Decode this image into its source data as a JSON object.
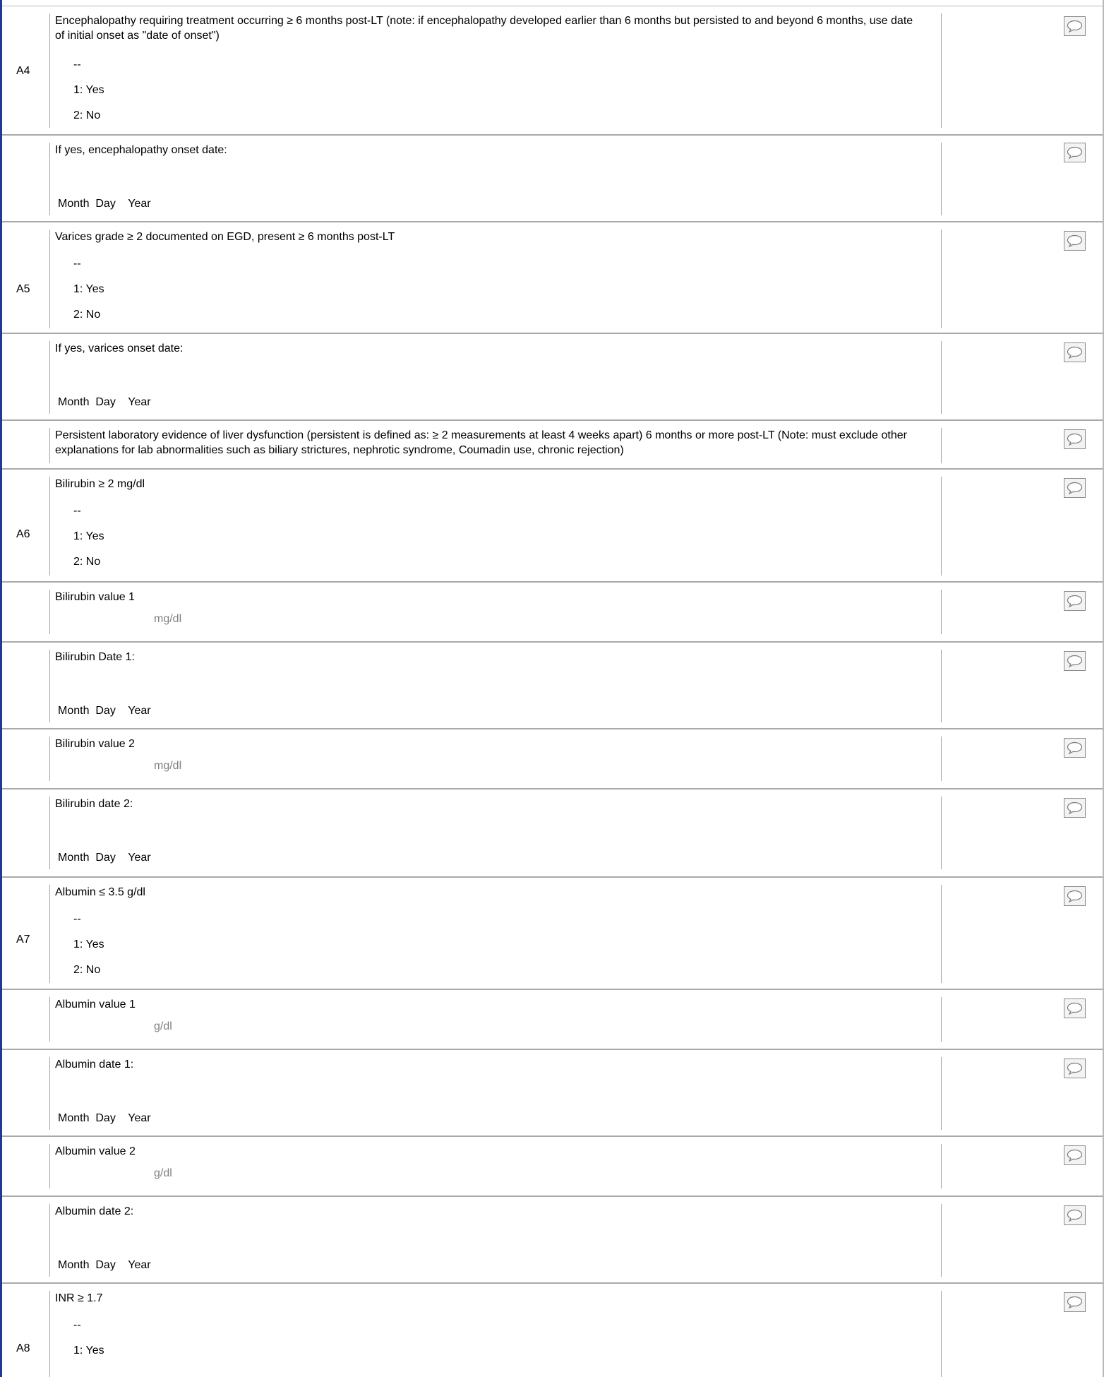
{
  "rows": [
    {
      "id": "A4",
      "question": "Encephalopathy requiring treatment occurring ≥ 6 months post-LT (note: if encephalopathy developed earlier than 6 months but persisted to and beyond 6 months, use date of initial onset as \"date of onset\")",
      "options": [
        "--",
        "1: Yes",
        "2: No"
      ]
    },
    {
      "question": "If yes, encephalopathy onset date:",
      "date_labels": "Month  Day    Year"
    },
    {
      "id": "A5",
      "question": "Varices grade ≥ 2 documented on EGD, present ≥ 6 months post-LT",
      "options": [
        "--",
        "1: Yes",
        "2: No"
      ]
    },
    {
      "question": "If yes, varices onset date:",
      "date_labels": "Month  Day    Year"
    },
    {
      "question": "Persistent laboratory evidence of liver dysfunction (persistent is defined as: ≥ 2 measurements at least 4 weeks apart) 6 months or more post-LT (Note: must exclude other explanations for lab abnormalities such as biliary strictures, nephrotic syndrome, Coumadin use, chronic rejection)"
    },
    {
      "id": "A6",
      "question": "Bilirubin ≥ 2 mg/dl",
      "options": [
        "--",
        "1: Yes",
        "2: No"
      ]
    },
    {
      "question": "Bilirubin value 1",
      "unit": "mg/dl"
    },
    {
      "question": "Bilirubin Date 1:",
      "date_labels": "Month  Day    Year"
    },
    {
      "question": "Bilirubin value 2",
      "unit": "mg/dl"
    },
    {
      "question": "Bilirubin date 2:",
      "date_labels": "Month  Day    Year"
    },
    {
      "id": "A7",
      "question": "Albumin ≤ 3.5 g/dl",
      "options": [
        "--",
        "1: Yes",
        "2: No"
      ]
    },
    {
      "question": "Albumin value 1",
      "unit": "g/dl"
    },
    {
      "question": "Albumin date 1:",
      "date_labels": "Month  Day    Year"
    },
    {
      "question": "Albumin value 2",
      "unit": "g/dl"
    },
    {
      "question": "Albumin date 2:",
      "date_labels": "Month  Day    Year"
    },
    {
      "id": "A8",
      "question": "INR ≥ 1.7",
      "options": [
        "--",
        "1: Yes"
      ]
    }
  ]
}
